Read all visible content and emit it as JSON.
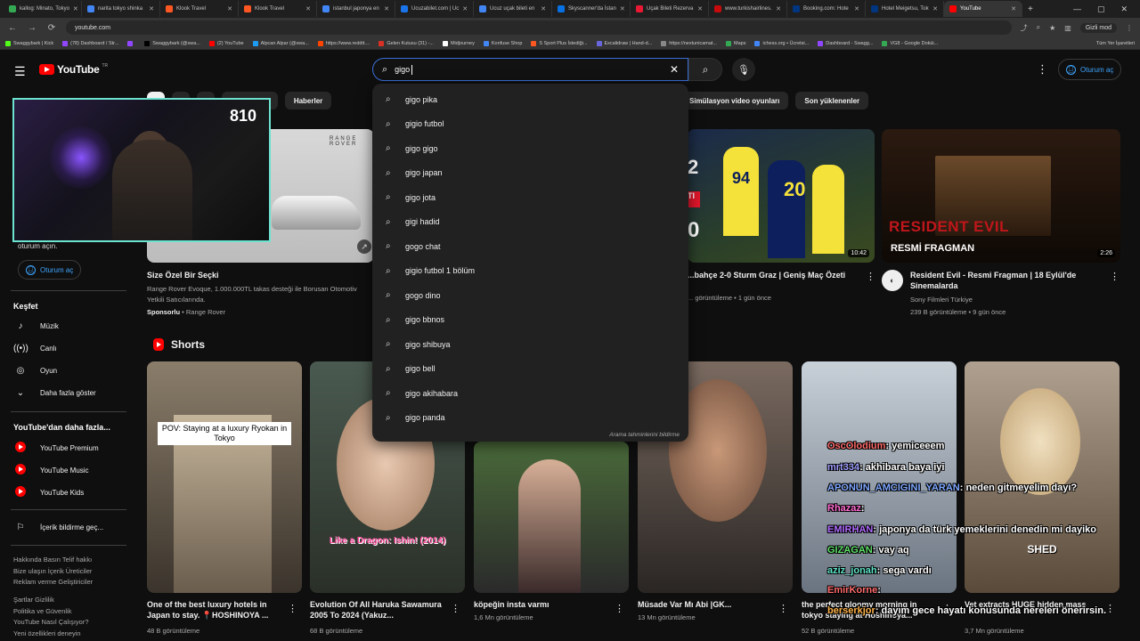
{
  "browser": {
    "tabs": [
      {
        "title": "kallog: Minato, Tokyo",
        "color": "#34a853"
      },
      {
        "title": "narita tokyo shinka",
        "color": "#4285f4"
      },
      {
        "title": "Klook Travel",
        "color": "#ff5722"
      },
      {
        "title": "Klook Travel",
        "color": "#ff5722"
      },
      {
        "title": "istanbul japonya en",
        "color": "#4285f4"
      },
      {
        "title": "Ucuzabilet.com | Uc",
        "color": "#1a73e8"
      },
      {
        "title": "Ucuz uçak bileti en",
        "color": "#4285f4"
      },
      {
        "title": "Skyscanner'da İstan",
        "color": "#0770e3"
      },
      {
        "title": "Uçak Bileti Rezerva",
        "color": "#e81932"
      },
      {
        "title": "www.turkishairlines.",
        "color": "#c70a0c"
      },
      {
        "title": "Booking.com: Hote",
        "color": "#003580"
      },
      {
        "title": "Hotel Meigetsu, Tok",
        "color": "#003580"
      },
      {
        "title": "YouTube",
        "color": "#ff0000"
      }
    ],
    "url": "youtube.com",
    "incognito": "Gizli mod",
    "bookmarks": [
      "Swaggybark | Kick",
      "(78) Dashboard / Str...",
      "",
      "Swaggybark (@swa...",
      "(2) YouTube",
      "Alpcan Alpar (@swa...",
      "https://www.reddit....",
      "Gelen Kutusu (31) -...",
      "Midjourney",
      "Konfuse Shop",
      "S Sport Plus İstediği...",
      "Excalidraw | Hand-d...",
      "https://nextunicamat...",
      "Maps",
      "ichess.org • Ücretsi...",
      "Dashboard - Swagg...",
      "VG8 - Google Doküi..."
    ],
    "bookmarks_all": "Tüm Yer İşaretleri"
  },
  "header": {
    "logo": "YouTube",
    "region": "TR",
    "search_value": "gigo",
    "signin": "Oturum aç"
  },
  "chips": [
    "",
    "",
    "",
    "Podcast'ler",
    "Haberler"
  ],
  "chips_right": [
    "Simülasyon video oyunları",
    "Son yüklenenler"
  ],
  "webcam": {
    "count": "810"
  },
  "sidebar": {
    "signin_text": "oturum açın.",
    "signin_button": "Oturum aç",
    "explore_title": "Keşfet",
    "explore": [
      "Müzik",
      "Canlı",
      "Oyun",
      "Daha fazla göster"
    ],
    "more_title": "YouTube'dan daha fazla...",
    "more": [
      "YouTube Premium",
      "YouTube Music",
      "YouTube Kids"
    ],
    "report": "İçerik bildirme geç...",
    "links1": "Hakkında  Basın  Telif hakkı\nBize ulaşın  İçerik Üreticiler\nReklam verme  Geliştiriciler",
    "links2": "Şartlar  Gizlilik\nPolitika ve Güvenlik\nYouTube Nasıl Çalışıyor?\nYeni özellikleri deneyin"
  },
  "videos": [
    {
      "title": "Size Özel Bir Seçki",
      "desc": "Range Rover Evoque, 1.000.000TL takas desteği ile Borusan Otomotiv Yetkili Satıcılarında.",
      "sponsor": "Sponsorlu",
      "channel": "Range Rover",
      "brand": "RANGE ROVER"
    },
    {
      "title": "...bahçe 2-0 Sturm Graz | Geniş Maç Özeti",
      "meta": "... görüntüleme • 1 gün önce",
      "duration": "10:42"
    },
    {
      "title": "Resident Evil - Resmi Fragman | 18 Eylül'de Sinemalarda",
      "channel": "Sony Filmleri Türkiye",
      "meta": "239 B görüntüleme • 9 gün önce",
      "duration": "2:26",
      "overlay1": "RESIDENT EVIL",
      "overlay2": "RESMİ FRAGMAN"
    }
  ],
  "shorts_title": "Shorts",
  "shorts": [
    {
      "title": "One of the best luxury hotels in Japan to stay. 📍HOSHINOYA ...",
      "views": "48 B görüntüleme",
      "overlay": "POV: Staying at a luxury Ryokan in Tokyo"
    },
    {
      "title": "Evolution Of All Haruka Sawamura 2005 To 2024 (Yakuz...",
      "views": "68 B görüntüleme",
      "overlay": "Like a Dragon: Ishin! (2014)"
    },
    {
      "title": "köpeğin insta varmı",
      "views": "1,6 Mn görüntüleme"
    },
    {
      "title": "Müsade Var Mı Abi |GK...",
      "views": "13 Mn görüntüleme"
    },
    {
      "title": "the perfect gloomy morning in tokyo staying at Hoshinoya...",
      "views": "52 B görüntüleme"
    },
    {
      "title": "Vet extracts HUGE hidden mass",
      "views": "3,7 Mn görüntüleme",
      "overlay": "SHED"
    }
  ],
  "chat": [
    {
      "user": "OscOlodium",
      "msg": ": yemiceeem",
      "color": "#ff6b6b"
    },
    {
      "user": "mrt334",
      "msg": ": akhibara baya iyi",
      "color": "#9e9eff"
    },
    {
      "user": "APONUN_AMCIGINI_YARAN",
      "msg": ": neden gitmeyelim dayı?",
      "color": "#7fa8ff"
    },
    {
      "user": "Rhazaz",
      "msg": ":",
      "color": "#ff6bd0"
    },
    {
      "user": "EMIRHAN",
      "msg": ": japonya da türk yemeklerini denedin mi dayiko",
      "color": "#b06bff"
    },
    {
      "user": "GIZAGAN",
      "msg": ": vay aq",
      "color": "#5fe36b"
    },
    {
      "user": "aziz_jonah",
      "msg": ": sega vardı",
      "color": "#5fe3c8"
    },
    {
      "user": "EmirKorne",
      "msg": ":",
      "color": "#ff6b6b"
    },
    {
      "user": "berserkjor",
      "msg": ": dayım gece hayatı konusunda nereleri önerirsin.",
      "color": "#ffb347"
    }
  ],
  "suggestions": [
    "gigo pika",
    "gigio futbol",
    "gigo gigo",
    "gigo japan",
    "gigo jota",
    "gigi hadid",
    "gogo chat",
    "gigio futbol 1 bölüm",
    "gogo dino",
    "gigo bbnos",
    "gigo shibuya",
    "gigo bell",
    "gigo akihabara",
    "gigo panda"
  ],
  "suggestions_footer": "Arama tahminlerini bildirme"
}
